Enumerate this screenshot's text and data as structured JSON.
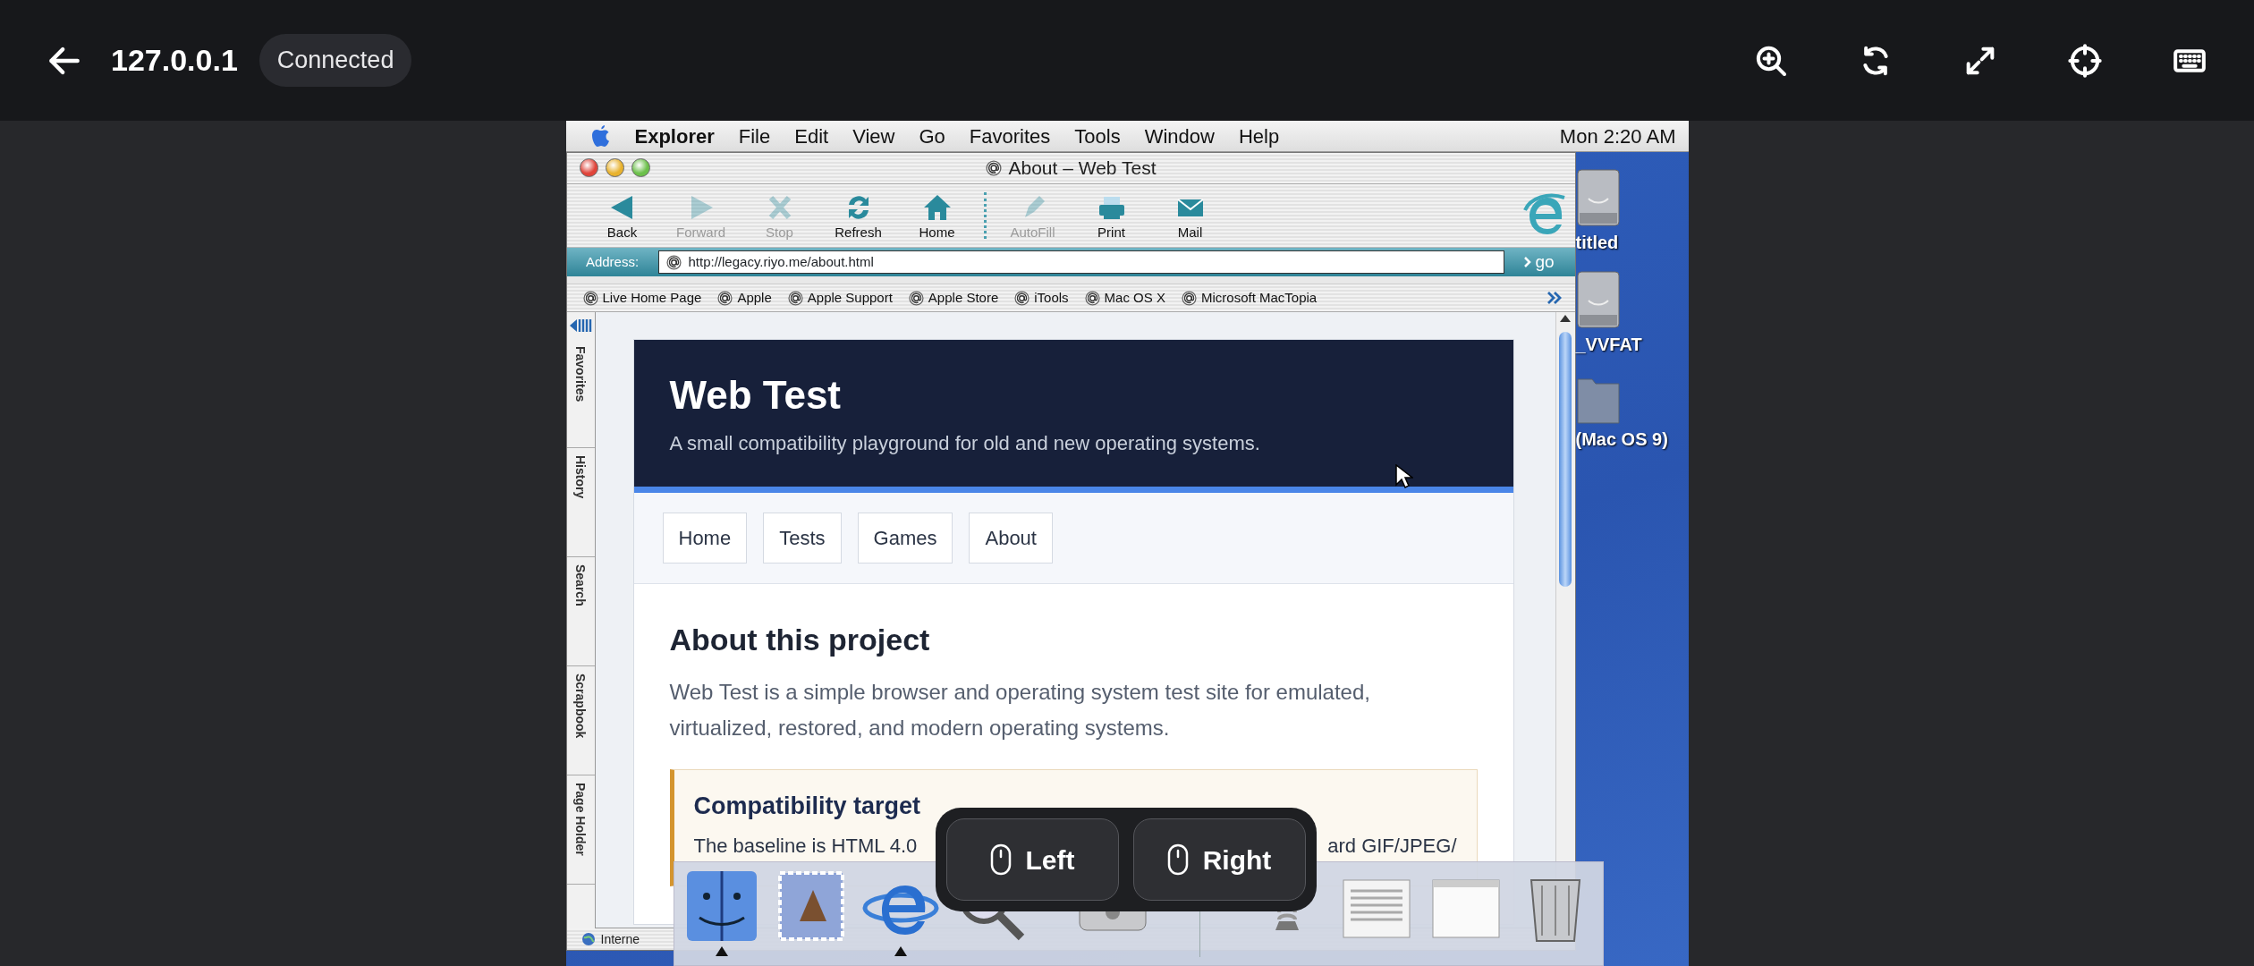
{
  "top_bar": {
    "host": "127.0.0.1",
    "status": "Connected"
  },
  "menu_bar": {
    "app": "Explorer",
    "items": [
      "File",
      "Edit",
      "View",
      "Go",
      "Favorites",
      "Tools",
      "Window",
      "Help"
    ],
    "clock": "Mon 2:20 AM"
  },
  "browser": {
    "title": "About – Web Test",
    "toolbar": [
      {
        "kind": "back",
        "label": "Back",
        "disabled": false
      },
      {
        "kind": "forward",
        "label": "Forward",
        "disabled": true
      },
      {
        "kind": "stop",
        "label": "Stop",
        "disabled": true
      },
      {
        "kind": "refresh",
        "label": "Refresh",
        "disabled": false
      },
      {
        "kind": "home",
        "label": "Home",
        "disabled": false
      }
    ],
    "toolbar_extras": [
      {
        "kind": "autofill",
        "label": "AutoFill",
        "disabled": true
      },
      {
        "kind": "print",
        "label": "Print",
        "disabled": false
      },
      {
        "kind": "mail",
        "label": "Mail",
        "disabled": false
      }
    ],
    "address_label": "Address:",
    "url": "http://legacy.riyo.me/about.html",
    "go": "go",
    "favorites": [
      "Live Home Page",
      "Apple",
      "Apple Support",
      "Apple Store",
      "iTools",
      "Mac OS X",
      "Microsoft MacTopia"
    ],
    "sidebar_tabs": [
      "Favorites",
      "History",
      "Search",
      "Scrapbook",
      "Page Holder"
    ],
    "status": "Interne"
  },
  "page": {
    "site_title": "Web Test",
    "tagline": "A small compatibility playground for old and new operating systems.",
    "nav": [
      "Home",
      "Tests",
      "Games",
      "About"
    ],
    "heading": "About this project",
    "intro": "Web Test is a simple browser and operating system test site for emulated, virtualized, restored, and modern operating systems.",
    "callout": {
      "title": "Compatibility target",
      "text_parts": [
        "The baseline is HTML 4.0",
        "ard GIF/JPEG/"
      ]
    }
  },
  "desktop_icons": [
    {
      "kind": "disk",
      "label": "titled"
    },
    {
      "kind": "disk",
      "label": "_VVFAT"
    },
    {
      "kind": "folder",
      "label": "(Mac OS 9)"
    }
  ],
  "dock": [
    {
      "kind": "finder",
      "running": true
    },
    {
      "kind": "mail",
      "running": false
    },
    {
      "kind": "explorer",
      "running": true
    },
    {
      "kind": "sherlock",
      "running": false
    },
    {
      "kind": "player",
      "running": false
    },
    {
      "kind": "divider"
    },
    {
      "kind": "spring",
      "running": false
    },
    {
      "kind": "document",
      "running": false
    },
    {
      "kind": "window",
      "running": false
    },
    {
      "kind": "trash",
      "running": false
    }
  ],
  "mouse_buttons": [
    "Left",
    "Right"
  ]
}
